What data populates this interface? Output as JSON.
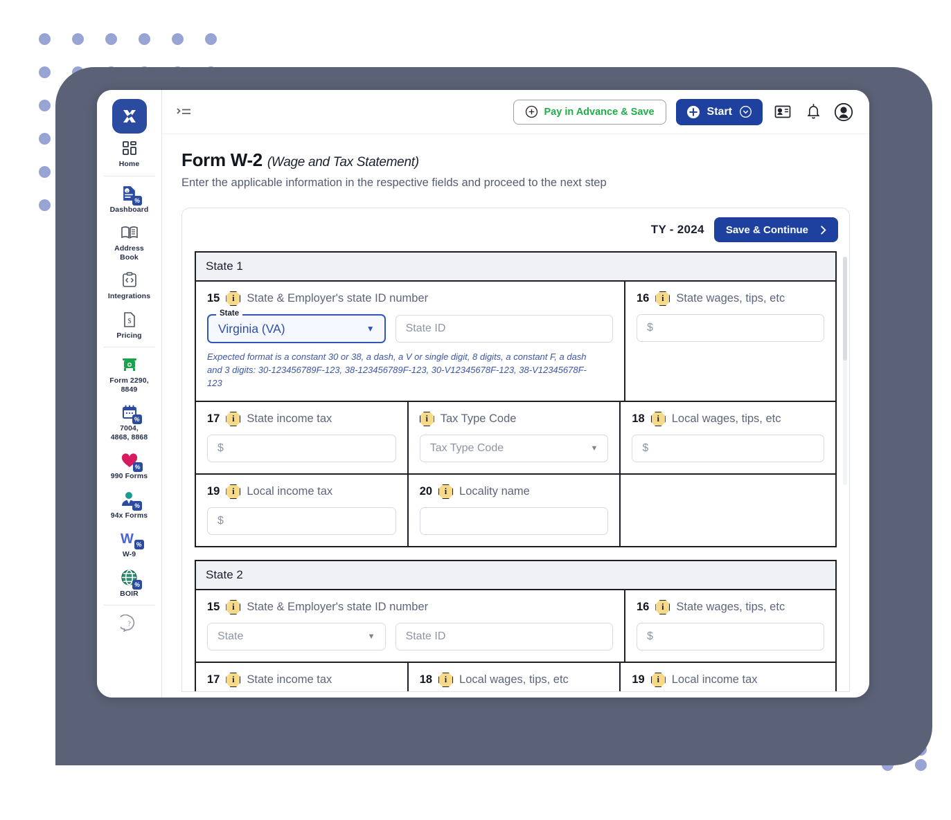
{
  "app": {
    "logo_glyph": "X",
    "collapse_icon": "collapse-menu-icon"
  },
  "sidebar": {
    "groups": [
      {
        "items": [
          {
            "label": "Home",
            "icon": "grid-icon"
          }
        ]
      },
      {
        "items": [
          {
            "label": "Dashboard",
            "icon": "document-tax-icon"
          },
          {
            "label": "Address\nBook",
            "icon": "address-book-icon"
          },
          {
            "label": "Integrations",
            "icon": "code-clipboard-icon"
          },
          {
            "label": "Pricing",
            "icon": "price-tag-icon"
          }
        ]
      },
      {
        "items": [
          {
            "label": "Form 2290,\n8849",
            "icon": "truck-icon"
          },
          {
            "label": "7004,\n4868, 8868",
            "icon": "calendar-tax-icon"
          },
          {
            "label": "990 Forms",
            "icon": "heart-tax-icon"
          },
          {
            "label": "94x Forms",
            "icon": "person-tax-icon"
          },
          {
            "label": "W-9",
            "icon": "w-tax-icon"
          },
          {
            "label": "BOIR",
            "icon": "globe-tax-icon"
          }
        ]
      },
      {
        "items": [
          {
            "label": "",
            "icon": "help-question-icon"
          }
        ]
      }
    ]
  },
  "topbar": {
    "pay_in_advance_label": "Pay in Advance & Save",
    "start_label": "Start",
    "icons": [
      "contact-card-icon",
      "bell-icon",
      "user-account-icon"
    ]
  },
  "page": {
    "title": "Form W-2",
    "title_sub": "(Wage and Tax Statement)",
    "description": "Enter the applicable information in the respective fields and proceed to the next step"
  },
  "card": {
    "tax_year_label": "TY - 2024",
    "save_continue_label": "Save & Continue"
  },
  "states": [
    {
      "heading": "State 1",
      "f15": {
        "num": "15",
        "label": "State & Employer's state ID number",
        "state_float_label": "State",
        "state_value": "Virginia (VA)",
        "state_id_placeholder": "State ID",
        "hint": "Expected format is a constant 30 or 38, a dash, a V or single digit, 8 digits, a constant F, a dash and 3 digits: 30-123456789F-123, 38-123456789F-123, 30-V12345678F-123, 38-V12345678F-123"
      },
      "f16": {
        "num": "16",
        "label": "State wages, tips, etc",
        "placeholder": "$"
      },
      "f17": {
        "num": "17",
        "label": "State income tax",
        "placeholder": "$"
      },
      "ftax": {
        "num": "",
        "label": "Tax Type Code",
        "placeholder": "Tax Type Code"
      },
      "f18": {
        "num": "18",
        "label": "Local wages, tips, etc",
        "placeholder": "$"
      },
      "f19": {
        "num": "19",
        "label": "Local income tax",
        "placeholder": "$"
      },
      "f20": {
        "num": "20",
        "label": "Locality name",
        "placeholder": ""
      }
    },
    {
      "heading": "State 2",
      "f15": {
        "num": "15",
        "label": "State & Employer's state ID number",
        "state_placeholder": "State",
        "state_id_placeholder": "State ID"
      },
      "f16": {
        "num": "16",
        "label": "State wages, tips, etc",
        "placeholder": "$"
      },
      "f17": {
        "num": "17",
        "label": "State income tax"
      },
      "f18": {
        "num": "18",
        "label": "Local wages, tips, etc"
      },
      "f19": {
        "num": "19",
        "label": "Local income tax"
      }
    }
  ],
  "colors": {
    "brand_blue": "#1e41a0",
    "accent_green": "#1fae4a",
    "backdrop": "#5b6176",
    "dot": "#97a4d4",
    "info_badge": "#f7d98a",
    "select_active_border": "#3156b8"
  }
}
